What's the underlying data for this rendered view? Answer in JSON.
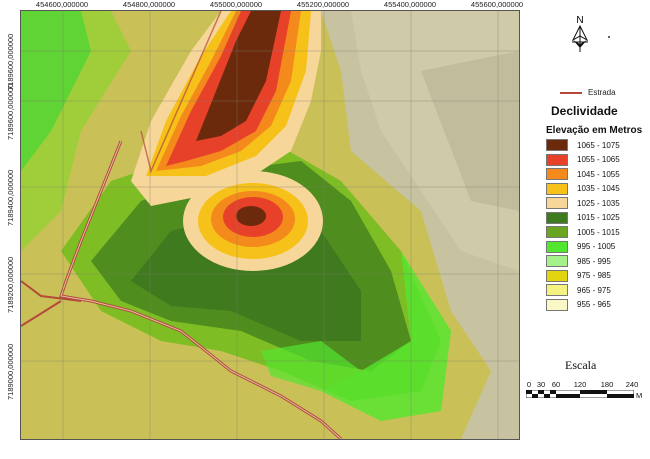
{
  "map": {
    "x_ticks": [
      "454600,000000",
      "454800,000000",
      "455000,000000",
      "455200,000000",
      "455400,000000",
      "455600,000000"
    ],
    "y_ticks": [
      "7189600,000000",
      "7189600,000000",
      "7189400,000000",
      "7189200,000000",
      "7189000,000000"
    ]
  },
  "legend": {
    "road_label": "Estrada",
    "title": "Declividade",
    "subtitle": "Elevação em Metros",
    "items": [
      {
        "label": "1065 - 1075",
        "color": "#6b2a0c"
      },
      {
        "label": "1055 - 1065",
        "color": "#e8412a"
      },
      {
        "label": "1045 - 1055",
        "color": "#f48a1c"
      },
      {
        "label": "1035 - 1045",
        "color": "#f6c21a"
      },
      {
        "label": "1025 - 1035",
        "color": "#f7d69a"
      },
      {
        "label": "1015 - 1025",
        "color": "#3f7a1e"
      },
      {
        "label": "1005 - 1015",
        "color": "#6aa51f"
      },
      {
        "label": "995 - 1005",
        "color": "#52e62e"
      },
      {
        "label": "985 - 995",
        "color": "#a6f28a"
      },
      {
        "label": "975 - 985",
        "color": "#e2d40e"
      },
      {
        "label": "965 - 975",
        "color": "#f6f280"
      },
      {
        "label": "955 - 965",
        "color": "#fbf8c8"
      }
    ]
  },
  "north_arrow": {
    "letter": "N"
  },
  "scale": {
    "title": "Escala",
    "numbers": [
      "0",
      "30",
      "60",
      "120",
      "180",
      "240"
    ],
    "unit": "M"
  }
}
